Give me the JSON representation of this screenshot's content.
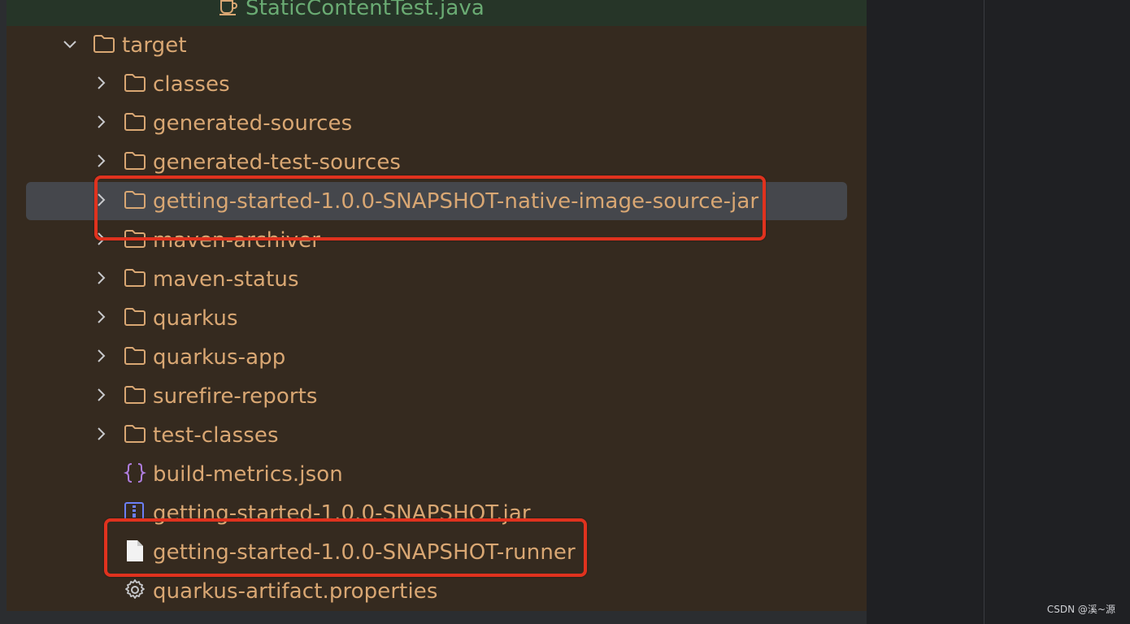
{
  "tree": {
    "top_file": {
      "label": "StaticContentTest.java",
      "icon": "java-class-icon"
    },
    "root_folder": {
      "label": "target",
      "icon": "folder-icon",
      "expanded": true
    },
    "folders": [
      {
        "label": "classes"
      },
      {
        "label": "generated-sources"
      },
      {
        "label": "generated-test-sources"
      },
      {
        "label": "getting-started-1.0.0-SNAPSHOT-native-image-source-jar",
        "selected": true
      },
      {
        "label": "maven-archiver"
      },
      {
        "label": "maven-status"
      },
      {
        "label": "quarkus"
      },
      {
        "label": "quarkus-app"
      },
      {
        "label": "surefire-reports"
      },
      {
        "label": "test-classes"
      }
    ],
    "files": [
      {
        "label": "build-metrics.json",
        "icon": "json-braces-icon"
      },
      {
        "label": "getting-started-1.0.0-SNAPSHOT.jar",
        "icon": "jar-archive-icon"
      },
      {
        "label": "getting-started-1.0.0-SNAPSHOT-runner",
        "icon": "file-icon"
      },
      {
        "label": "quarkus-artifact.properties",
        "icon": "gear-icon"
      }
    ]
  },
  "watermark": "CSDN @溪~源",
  "colors": {
    "panel_bg": "#352a1f",
    "label_text": "#d9a773",
    "selection_bg": "#45474c",
    "highlight_box": "#e0321e",
    "java_green": "#6aab73",
    "json_purple": "#b07ee0",
    "jar_blue": "#6b7ff5"
  }
}
